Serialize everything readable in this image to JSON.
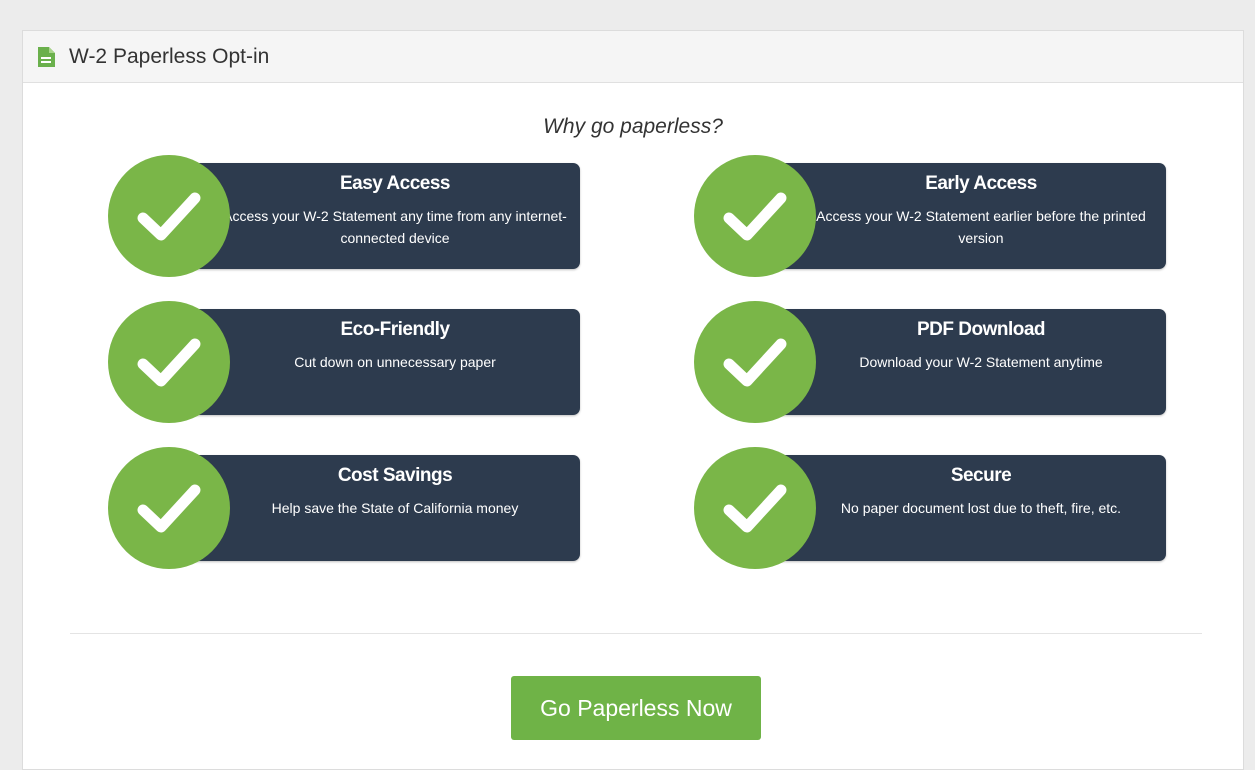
{
  "header": {
    "title": "W-2 Paperless Opt-in",
    "icon": "document-icon"
  },
  "subtitle": "Why go paperless?",
  "features": [
    {
      "title": "Easy Access",
      "description": "Access your W-2 Statement any time from any internet-connected device"
    },
    {
      "title": "Early Access",
      "description": "Access your W-2 Statement earlier before the printed version"
    },
    {
      "title": "Eco-Friendly",
      "description": "Cut down on unnecessary paper"
    },
    {
      "title": "PDF Download",
      "description": "Download your W-2 Statement anytime"
    },
    {
      "title": "Cost Savings",
      "description": "Help save the State of California money"
    },
    {
      "title": "Secure",
      "description": "No paper document lost due to theft, fire, etc."
    }
  ],
  "cta": {
    "label": "Go Paperless Now"
  },
  "colors": {
    "accent_green": "#7ab648",
    "card_navy": "#2d3b4e",
    "button_green": "#6fb347"
  }
}
